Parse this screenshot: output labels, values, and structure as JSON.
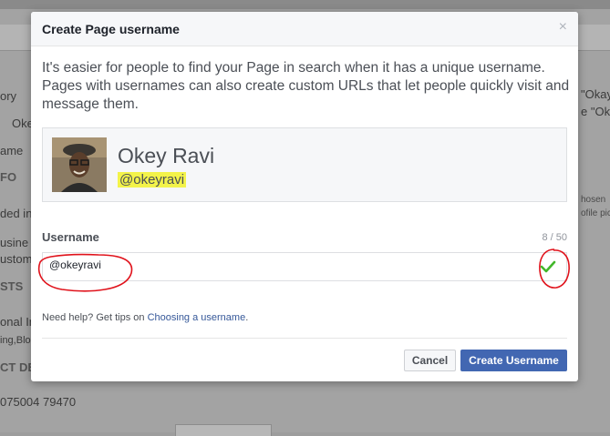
{
  "background": {
    "texts": [
      "ory",
      "Oke",
      "ame",
      "FO",
      "ded in",
      "usine",
      "ustom",
      "STS",
      "onal In",
      "ing,Blo",
      "CT DE",
      "075004 79470",
      "\"Okay",
      "e \"Oke",
      "hosen",
      "ofile pic"
    ]
  },
  "modal": {
    "title": "Create Page username",
    "close_glyph": "×",
    "intro": "It's easier for people to find your Page in search when it has a unique username. Pages with usernames can also create custom URLs that let people quickly visit and message them.",
    "page_name": "Okey Ravi",
    "page_handle": "@okeyravi",
    "username_label": "Username",
    "counter": "8 / 50",
    "username_value": "@okeyravi",
    "help_text": "Need help? Get tips on ",
    "help_link": "Choosing a username",
    "help_suffix": ".",
    "cancel_label": "Cancel",
    "create_label": "Create Username"
  },
  "colors": {
    "primary": "#4267b2",
    "highlight": "#f3f34a",
    "check": "#42b72a",
    "annotation": "#e0121b"
  }
}
